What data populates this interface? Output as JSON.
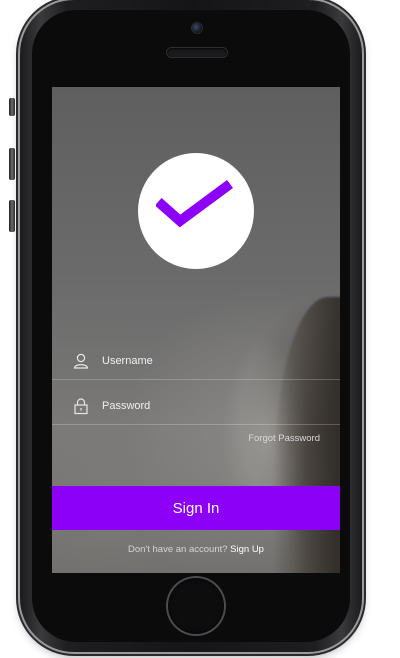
{
  "login": {
    "username_placeholder": "Username",
    "password_placeholder": "Password",
    "forgot_password": "Forgot Password",
    "sign_in_button": "Sign In",
    "no_account_text": "Don't have an account?",
    "sign_up_link": "Sign Up"
  },
  "icons": {
    "logo": "checkmark-icon",
    "username": "user-icon",
    "password": "lock-icon"
  },
  "colors": {
    "accent": "#8c00f7",
    "logo_background": "#ffffff"
  }
}
